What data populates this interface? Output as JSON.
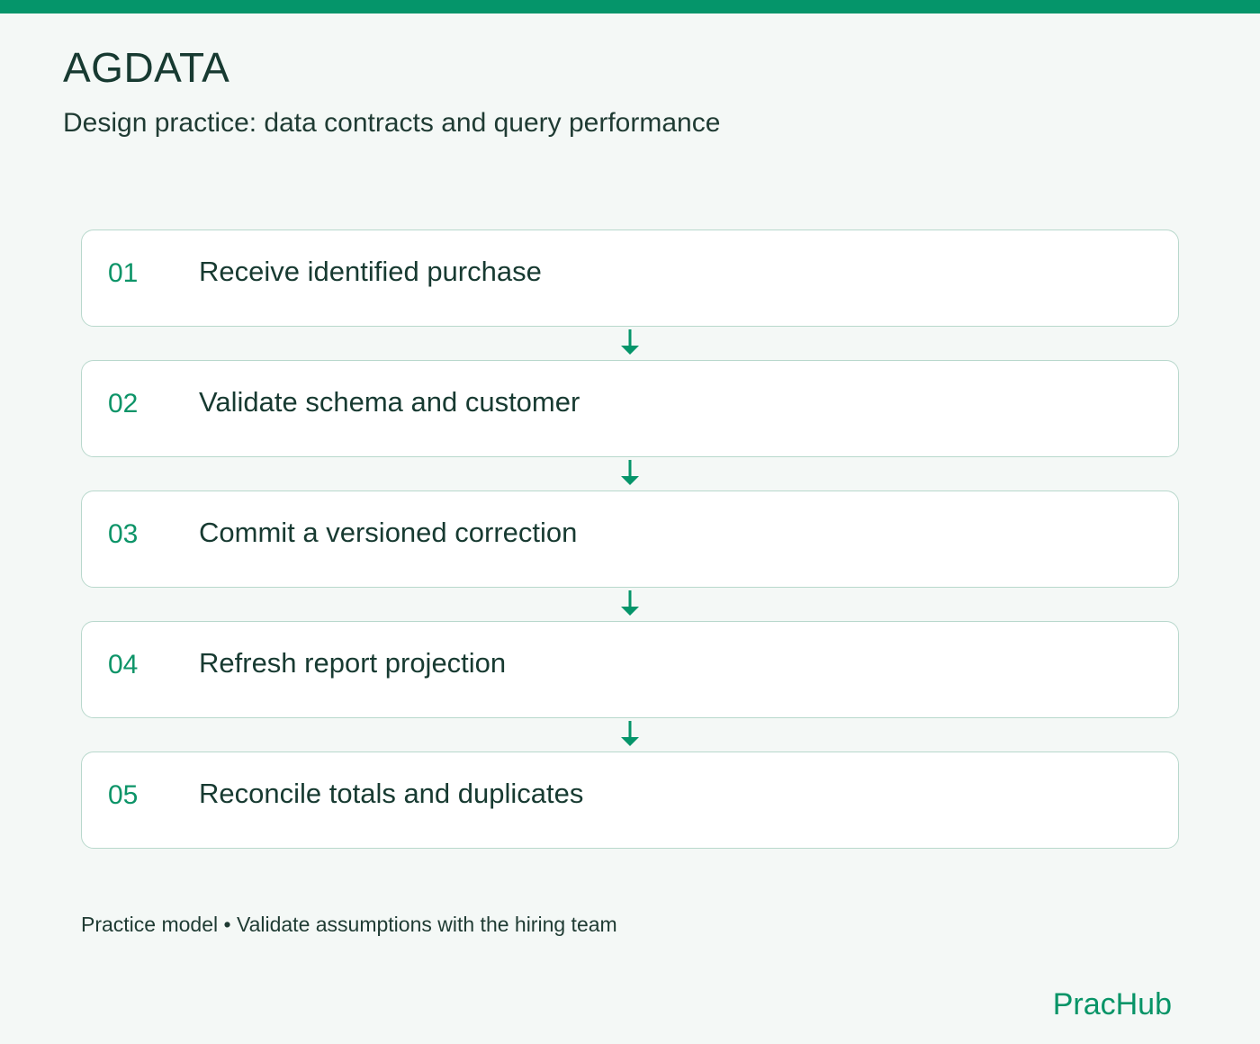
{
  "header": {
    "title": "AGDATA",
    "subtitle": "Design practice: data contracts and query performance"
  },
  "steps": [
    {
      "number": "01",
      "label": "Receive identified purchase"
    },
    {
      "number": "02",
      "label": "Validate schema and customer"
    },
    {
      "number": "03",
      "label": "Commit a versioned correction"
    },
    {
      "number": "04",
      "label": "Refresh report projection"
    },
    {
      "number": "05",
      "label": "Reconcile totals and duplicates"
    }
  ],
  "footer": {
    "note": "Practice model • Validate assumptions with the hiring team",
    "brand": "PracHub"
  },
  "colors": {
    "accent": "#05956a",
    "text": "#173a31",
    "card_border": "#b8d8cc",
    "background": "#f4f8f6"
  },
  "icons": {
    "connector": "arrow-down-icon"
  }
}
